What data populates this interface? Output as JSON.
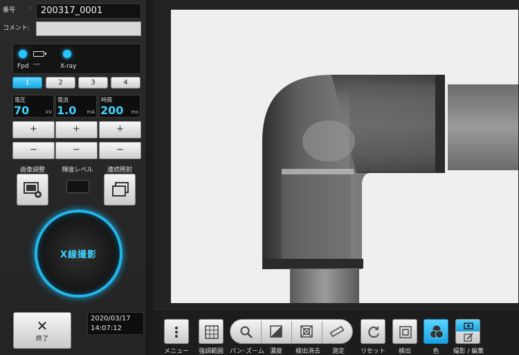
{
  "header": {
    "id_label": "番号",
    "id_colon": ":",
    "id_value": "200317_0001",
    "comment_label": "コメント:",
    "comment_value": ""
  },
  "status": {
    "fpd_label": "Fpd",
    "fpd_battery": "---",
    "xray_label": "X-ray",
    "indicator_color": "#27c6ff"
  },
  "channels": [
    "1",
    "2",
    "3",
    "4"
  ],
  "active_channel": "1",
  "params": [
    {
      "name": "電圧",
      "value": "70",
      "unit": "kV"
    },
    {
      "name": "電流",
      "value": "1.0",
      "unit": "mA"
    },
    {
      "name": "時間",
      "value": "200",
      "unit": "ms"
    }
  ],
  "steppers": {
    "plus": "+",
    "minus": "−"
  },
  "tools": {
    "image_adjust": "画像調整",
    "brightness_level": "輝度レベル",
    "continuous": "連続照射"
  },
  "xray_button": "X線撮影",
  "exit": {
    "icon": "✕",
    "label": "終了"
  },
  "datetime": {
    "date": "2020/03/17",
    "time": "14:07:12"
  },
  "toolbar": {
    "menu": "メニュー",
    "emphasis_range": "強調範囲",
    "pan_zoom": "パン･ズーム",
    "density": "濃度",
    "detect_clear": "検出消去",
    "measure": "測定",
    "reset": "リセット",
    "detect": "検出",
    "color": "色",
    "capture_edit": "撮影 / 編集"
  },
  "colors": {
    "accent": "#27c6ff",
    "panel": "#262626"
  }
}
